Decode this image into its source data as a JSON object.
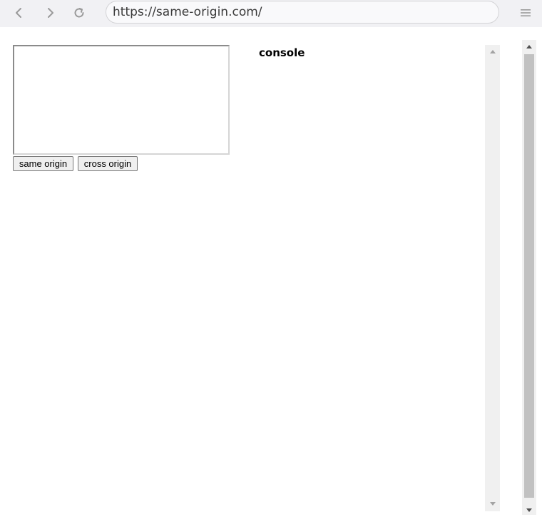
{
  "browser": {
    "url": "https://same-origin.com/",
    "back_icon": "chevron-left-icon",
    "forward_icon": "chevron-right-icon",
    "reload_icon": "reload-icon",
    "menu_icon": "hamburger-menu-icon"
  },
  "page": {
    "buttons": {
      "same_origin": "same origin",
      "cross_origin": "cross origin"
    },
    "console": {
      "title": "console"
    }
  }
}
